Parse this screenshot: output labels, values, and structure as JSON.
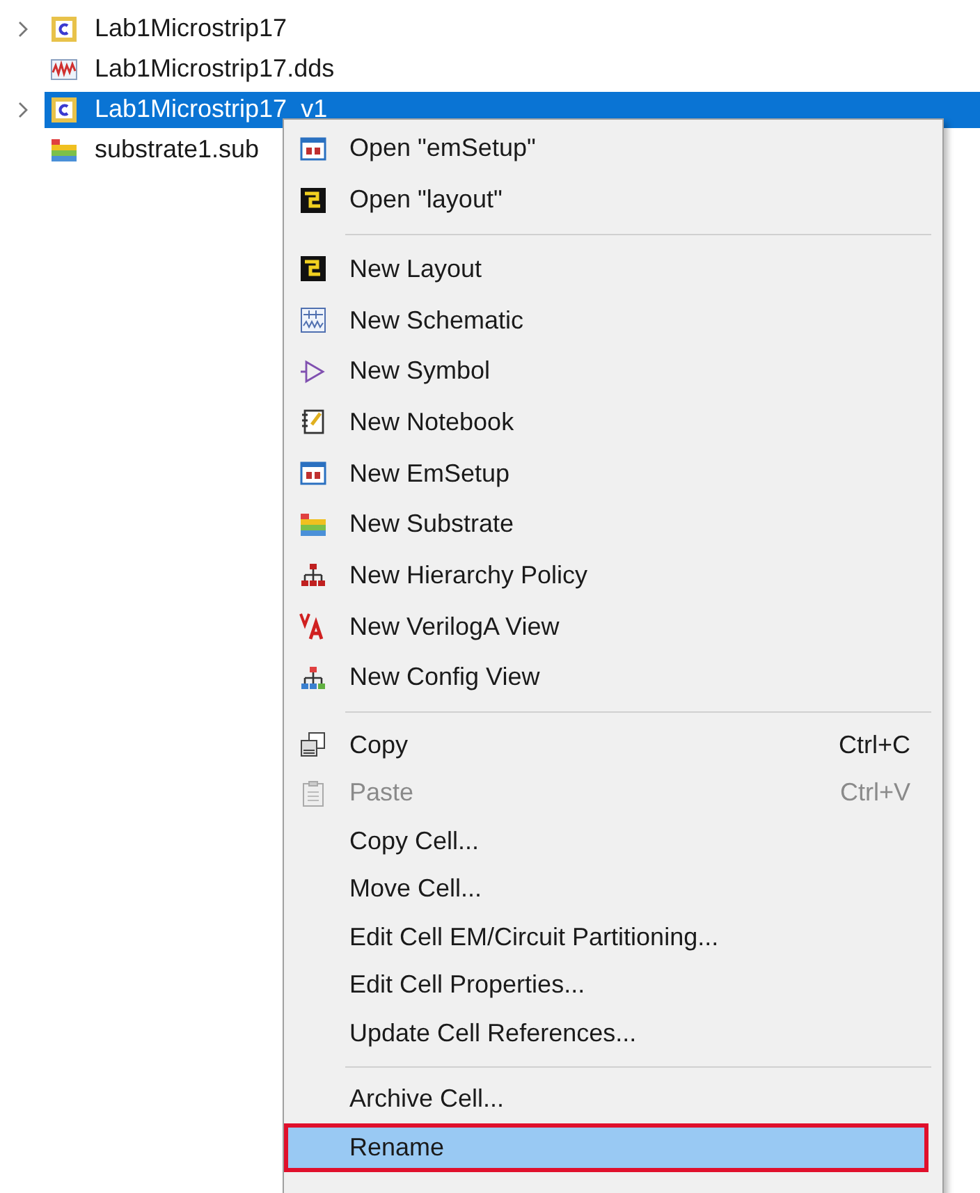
{
  "tree": [
    {
      "label": "Lab1Microstrip17",
      "has_children": true,
      "selected": false
    },
    {
      "label": "Lab1Microstrip17.dds",
      "has_children": false,
      "selected": false
    },
    {
      "label": "Lab1Microstrip17_v1",
      "has_children": true,
      "selected": true
    },
    {
      "label": "substrate1.sub",
      "has_children": false,
      "selected": false
    }
  ],
  "context_menu": {
    "groups": [
      {
        "items": [
          {
            "label": "Open \"emSetup\"",
            "disabled": false,
            "selected": false
          },
          {
            "label": "Open \"layout\"",
            "disabled": false,
            "selected": false
          }
        ]
      },
      {
        "items": [
          {
            "label": "New Layout",
            "disabled": false,
            "selected": false
          },
          {
            "label": "New Schematic",
            "disabled": false,
            "selected": false
          },
          {
            "label": "New Symbol",
            "disabled": false,
            "selected": false
          },
          {
            "label": "New Notebook",
            "disabled": false,
            "selected": false
          },
          {
            "label": "New EmSetup",
            "disabled": false,
            "selected": false
          },
          {
            "label": "New Substrate",
            "disabled": false,
            "selected": false
          },
          {
            "label": "New Hierarchy Policy",
            "disabled": false,
            "selected": false
          },
          {
            "label": "New VerilogA View",
            "disabled": false,
            "selected": false
          },
          {
            "label": "New Config View",
            "disabled": false,
            "selected": false
          }
        ]
      },
      {
        "items": [
          {
            "label": "Copy",
            "shortcut": "Ctrl+C",
            "disabled": false,
            "selected": false
          },
          {
            "label": "Paste",
            "shortcut": "Ctrl+V",
            "disabled": true,
            "selected": false
          },
          {
            "label": "Copy Cell...",
            "disabled": false,
            "selected": false
          },
          {
            "label": "Move Cell...",
            "disabled": false,
            "selected": false
          },
          {
            "label": "Edit Cell EM/Circuit Partitioning...",
            "disabled": false,
            "selected": false
          },
          {
            "label": "Edit Cell Properties...",
            "disabled": false,
            "selected": false
          },
          {
            "label": "Update Cell References...",
            "disabled": false,
            "selected": false
          }
        ]
      },
      {
        "items": [
          {
            "label": "Archive Cell...",
            "disabled": false,
            "selected": false
          },
          {
            "label": "Rename",
            "disabled": false,
            "selected": true
          }
        ]
      }
    ]
  }
}
